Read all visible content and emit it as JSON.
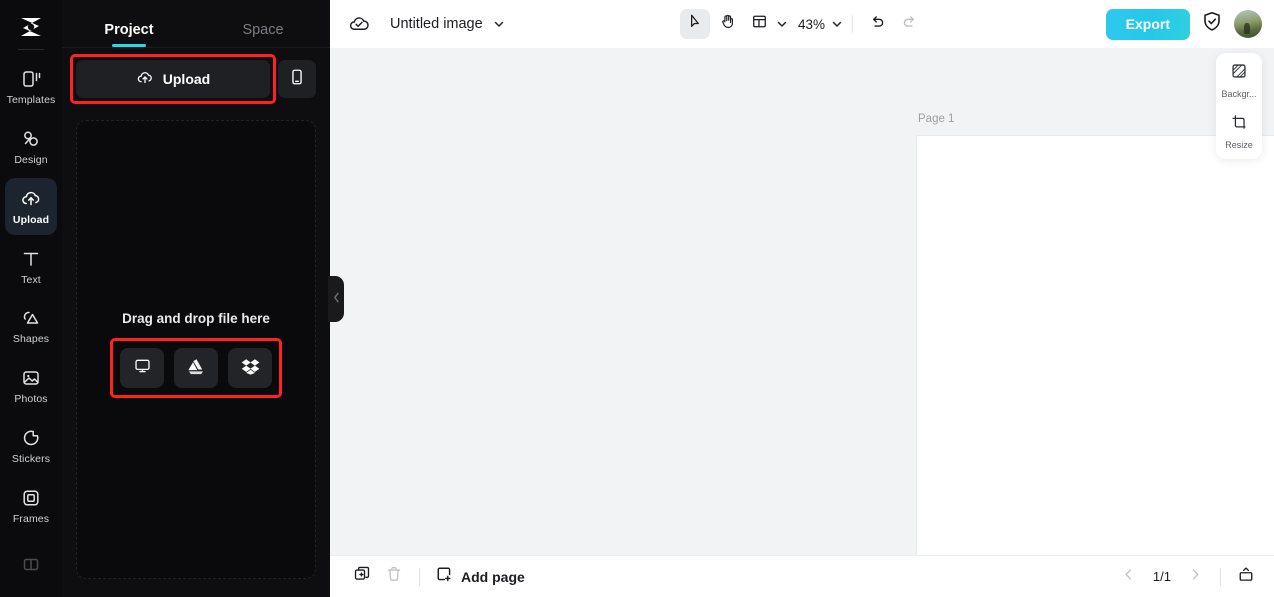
{
  "app": {
    "logo_icon": "capcut-logo-icon"
  },
  "rail": {
    "items": [
      {
        "label": "Templates",
        "icon": "templates-icon",
        "active": false
      },
      {
        "label": "Design",
        "icon": "design-icon",
        "active": false
      },
      {
        "label": "Upload",
        "icon": "upload-cloud-icon",
        "active": true
      },
      {
        "label": "Text",
        "icon": "text-icon",
        "active": false
      },
      {
        "label": "Shapes",
        "icon": "shapes-icon",
        "active": false
      },
      {
        "label": "Photos",
        "icon": "photos-icon",
        "active": false
      },
      {
        "label": "Stickers",
        "icon": "stickers-icon",
        "active": false
      },
      {
        "label": "Frames",
        "icon": "frames-icon",
        "active": false
      }
    ]
  },
  "panel": {
    "tabs": [
      {
        "label": "Project",
        "active": true
      },
      {
        "label": "Space",
        "active": false
      }
    ],
    "upload_label": "Upload",
    "upload_icon": "upload-cloud-icon",
    "mobile_icon": "mobile-phone-icon",
    "dropzone_text": "Drag and drop file here",
    "sources": [
      {
        "name": "computer",
        "icon": "monitor-icon"
      },
      {
        "name": "google-drive",
        "icon": "google-drive-icon"
      },
      {
        "name": "dropbox",
        "icon": "dropbox-icon"
      }
    ],
    "collapse_icon": "chevron-left-icon",
    "highlight_color": "#ff2222"
  },
  "topbar": {
    "cloud_icon": "cloud-saved-icon",
    "doc_title": "Untitled image",
    "title_chevron_icon": "chevron-down-icon",
    "tools": [
      {
        "name": "select-tool",
        "icon": "cursor-arrow-icon",
        "active": true,
        "disabled": false
      },
      {
        "name": "hand-tool",
        "icon": "hand-icon",
        "active": false,
        "disabled": false
      },
      {
        "name": "layout-tool",
        "icon": "layout-icon",
        "active": false,
        "disabled": false
      }
    ],
    "layout_chevron_icon": "chevron-down-icon",
    "zoom_level": "43%",
    "zoom_chevron_icon": "chevron-down-icon",
    "undo": {
      "icon": "undo-icon",
      "disabled": false
    },
    "redo": {
      "icon": "redo-icon",
      "disabled": true
    },
    "export_label": "Export",
    "export_color": "#28c8e8",
    "shield_icon": "shield-check-icon",
    "avatar_icon": "user-avatar"
  },
  "canvas": {
    "page_label": "Page 1",
    "background": "#ffffff"
  },
  "side_tools": [
    {
      "label": "Backgr...",
      "icon": "background-icon"
    },
    {
      "label": "Resize",
      "icon": "resize-icon"
    }
  ],
  "bottombar": {
    "duplicate": {
      "icon": "duplicate-page-icon",
      "disabled": false
    },
    "delete": {
      "icon": "trash-icon",
      "disabled": true
    },
    "add_page_label": "Add page",
    "add_page_icon": "add-page-icon",
    "prev_icon": "chevron-left-icon",
    "next_icon": "chevron-right-icon",
    "page_count": "1/1",
    "present_icon": "present-box-icon"
  }
}
